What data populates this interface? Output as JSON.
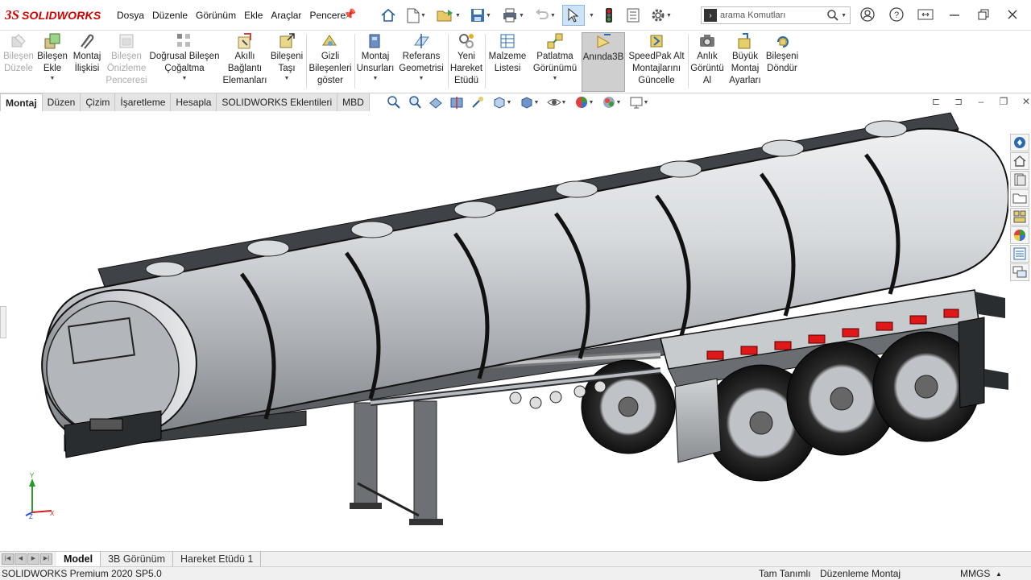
{
  "app": {
    "brand": "SOLIDWORKS",
    "logo_mark": "3S"
  },
  "menu": [
    "Dosya",
    "Düzenle",
    "Görünüm",
    "Ekle",
    "Araçlar",
    "Pencere"
  ],
  "search": {
    "placeholder": "arama Komutları",
    "icon": "search-icon"
  },
  "ribbon": {
    "buttons": [
      {
        "label": "Bileşen Düzele",
        "lines": [
          "Bileşen",
          "Düzele"
        ],
        "icon": "edit-component-icon",
        "disabled": true
      },
      {
        "label": "Bileşen Ekle",
        "lines": [
          "Bileşen",
          "Ekle"
        ],
        "icon": "insert-component-icon",
        "dropdown": true
      },
      {
        "label": "Montaj İlişkisi",
        "lines": [
          "Montaj",
          "İlişkisi"
        ],
        "icon": "mate-icon"
      },
      {
        "label": "Bileşen Önizleme Penceresi",
        "lines": [
          "Bileşen",
          "Önizleme",
          "Penceresi"
        ],
        "icon": "component-preview-icon",
        "disabled": true
      },
      {
        "label": "Doğrusal Bileşen Çoğaltma",
        "lines": [
          "Doğrusal Bileşen",
          "Çoğaltma"
        ],
        "icon": "linear-pattern-icon",
        "dropdown": true
      },
      {
        "label": "Akıllı Bağlantı Elemanları",
        "lines": [
          "Akıllı",
          "Bağlantı",
          "Elemanları"
        ],
        "icon": "smart-fasteners-icon"
      },
      {
        "label": "Bileşeni Taşı",
        "lines": [
          "Bileşeni",
          "Taşı"
        ],
        "icon": "move-component-icon",
        "dropdown": true
      },
      {
        "label": "Gizli Bileşenleri göster",
        "lines": [
          "Gizli",
          "Bileşenleri",
          "göster"
        ],
        "icon": "show-hidden-icon"
      },
      {
        "label": "Montaj Unsurları",
        "lines": [
          "Montaj",
          "Unsurları"
        ],
        "icon": "assembly-features-icon",
        "dropdown": true
      },
      {
        "label": "Referans Geometrisi",
        "lines": [
          "Referans",
          "Geometrisi"
        ],
        "icon": "reference-geometry-icon",
        "dropdown": true
      },
      {
        "label": "Yeni Hareket Etüdü",
        "lines": [
          "Yeni",
          "Hareket",
          "Etüdü"
        ],
        "icon": "new-motion-study-icon"
      },
      {
        "label": "Malzeme Listesi",
        "lines": [
          "Malzeme",
          "Listesi"
        ],
        "icon": "bill-of-materials-icon"
      },
      {
        "label": "Patlatma Görünümü",
        "lines": [
          "Patlatma",
          "Görünümü"
        ],
        "icon": "exploded-view-icon",
        "dropdown": true
      },
      {
        "label": "Anında3B",
        "lines": [
          "Anında3B"
        ],
        "icon": "instant3d-icon",
        "active": true
      },
      {
        "label": "SpeedPak Alt Montajlarını Güncelle",
        "lines": [
          "SpeedPak Alt",
          "Montajlarını",
          "Güncelle"
        ],
        "icon": "speedpak-icon"
      },
      {
        "label": "Anlık Görüntü Al",
        "lines": [
          "Anlık",
          "Görüntü",
          "Al"
        ],
        "icon": "snapshot-icon"
      },
      {
        "label": "Büyük Montaj Ayarları",
        "lines": [
          "Büyük",
          "Montaj",
          "Ayarları"
        ],
        "icon": "large-assembly-icon"
      },
      {
        "label": "Bileşeni Döndür",
        "lines": [
          "Bileşeni",
          "Döndür"
        ],
        "icon": "rotate-component-icon"
      }
    ]
  },
  "tabs": [
    "Montaj",
    "Düzen",
    "Çizim",
    "İşaretleme",
    "Hesapla",
    "SOLIDWORKS Eklentileri",
    "MBD"
  ],
  "active_tab": "Montaj",
  "bottom_tabs": [
    "Model",
    "3B Görünüm",
    "Hareket Etüdü 1"
  ],
  "active_bottom_tab": "Model",
  "status": {
    "version": "SOLIDWORKS Premium 2020 SP5.0",
    "definition": "Tam Tanımlı",
    "mode": "Düzenleme Montaj",
    "units": "MMGS"
  },
  "colors": {
    "brand_red": "#d40000",
    "selection_blue": "#cfe3f7",
    "tank_steel": "#c9ccd0",
    "reflector_red": "#e01818"
  },
  "taskpane_icons": [
    "resources-icon",
    "home-icon",
    "design-library-icon",
    "file-explorer-icon",
    "view-palette-icon",
    "appearances-icon",
    "custom-properties-icon",
    "forum-icon"
  ]
}
